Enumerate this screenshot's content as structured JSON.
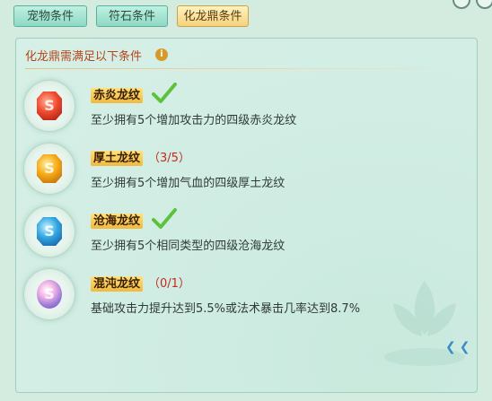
{
  "tabs": [
    {
      "label": "宠物条件",
      "active": false
    },
    {
      "label": "符石条件",
      "active": false
    },
    {
      "label": "化龙鼎条件",
      "active": true
    }
  ],
  "panel": {
    "title": "化龙鼎需满足以下条件",
    "info_icon": "i"
  },
  "conditions": [
    {
      "name": "赤炎龙纹",
      "status": "complete",
      "progress": "",
      "desc": "至少拥有5个增加攻击力的四级赤炎龙纹",
      "gem": "red-gem-icon"
    },
    {
      "name": "厚土龙纹",
      "status": "incomplete",
      "progress": "（3/5）",
      "desc": "至少拥有5个增加气血的四级厚土龙纹",
      "gem": "yellow-gem-icon"
    },
    {
      "name": "沧海龙纹",
      "status": "complete",
      "progress": "",
      "desc": "至少拥有5个相同类型的四级沧海龙纹",
      "gem": "blue-gem-icon"
    },
    {
      "name": "混沌龙纹",
      "status": "incomplete",
      "progress": "（0/1）",
      "desc": "基础攻击力提升达到5.5%或法术暴击几率达到8.7%",
      "gem": "chaos-gem-icon"
    }
  ],
  "colors": {
    "title": "#b6451c",
    "progress": "#c42a1a",
    "check": "#5cc23a"
  }
}
